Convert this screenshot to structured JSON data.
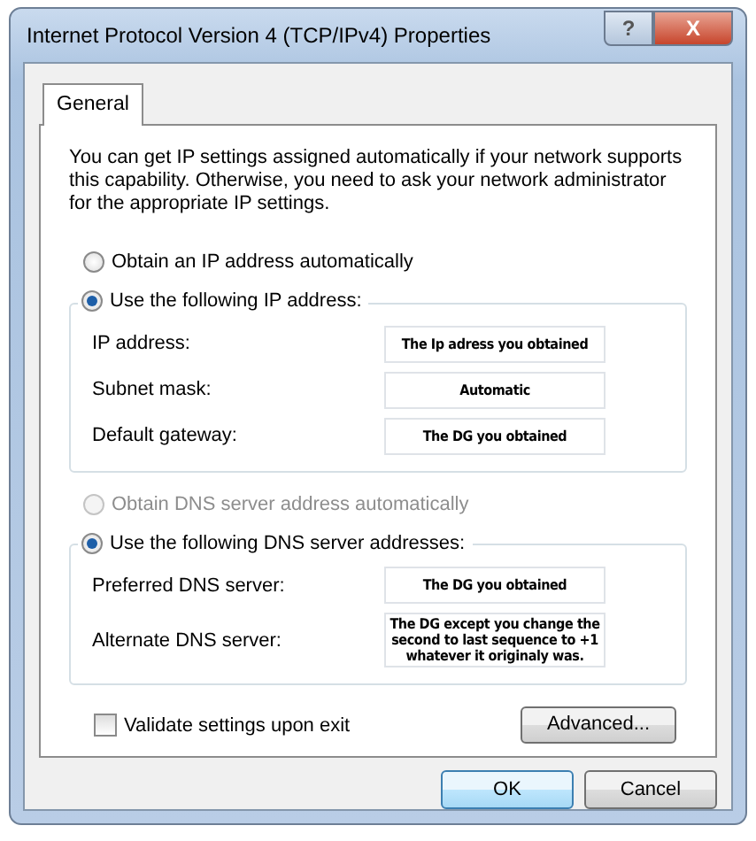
{
  "window": {
    "title": "Internet Protocol Version 4 (TCP/IPv4) Properties",
    "help": "?",
    "close": "X"
  },
  "tabs": [
    {
      "label": "General",
      "selected": true
    }
  ],
  "intro": "You can get IP settings assigned automatically if your network supports this capability. Otherwise, you need to ask your network administrator for the appropriate IP settings.",
  "ip_mode": [
    {
      "label": "Obtain an IP address automatically",
      "selected": false,
      "disabled": false
    },
    {
      "label": "Use the following IP address:",
      "selected": true,
      "disabled": false
    }
  ],
  "ip_fields": [
    {
      "label": "IP address:",
      "value": "The Ip adress you obtained"
    },
    {
      "label": "Subnet mask:",
      "value": "Automatic"
    },
    {
      "label": "Default gateway:",
      "value": "The DG you obtained"
    }
  ],
  "dns_mode": [
    {
      "label": "Obtain DNS server address automatically",
      "selected": false,
      "disabled": true
    },
    {
      "label": "Use the following DNS server addresses:",
      "selected": true,
      "disabled": false
    }
  ],
  "dns_fields": [
    {
      "label": "Preferred DNS server:",
      "value": "The DG you obtained"
    },
    {
      "label": "Alternate DNS server:",
      "value": "The DG except you change the second to last sequence to +1 whatever it originaly was."
    }
  ],
  "validate": {
    "label": "Validate settings upon exit",
    "checked": false
  },
  "advanced_button": "Advanced...",
  "footer_buttons": [
    {
      "label": "OK",
      "default": true
    },
    {
      "label": "Cancel",
      "default": false
    }
  ]
}
